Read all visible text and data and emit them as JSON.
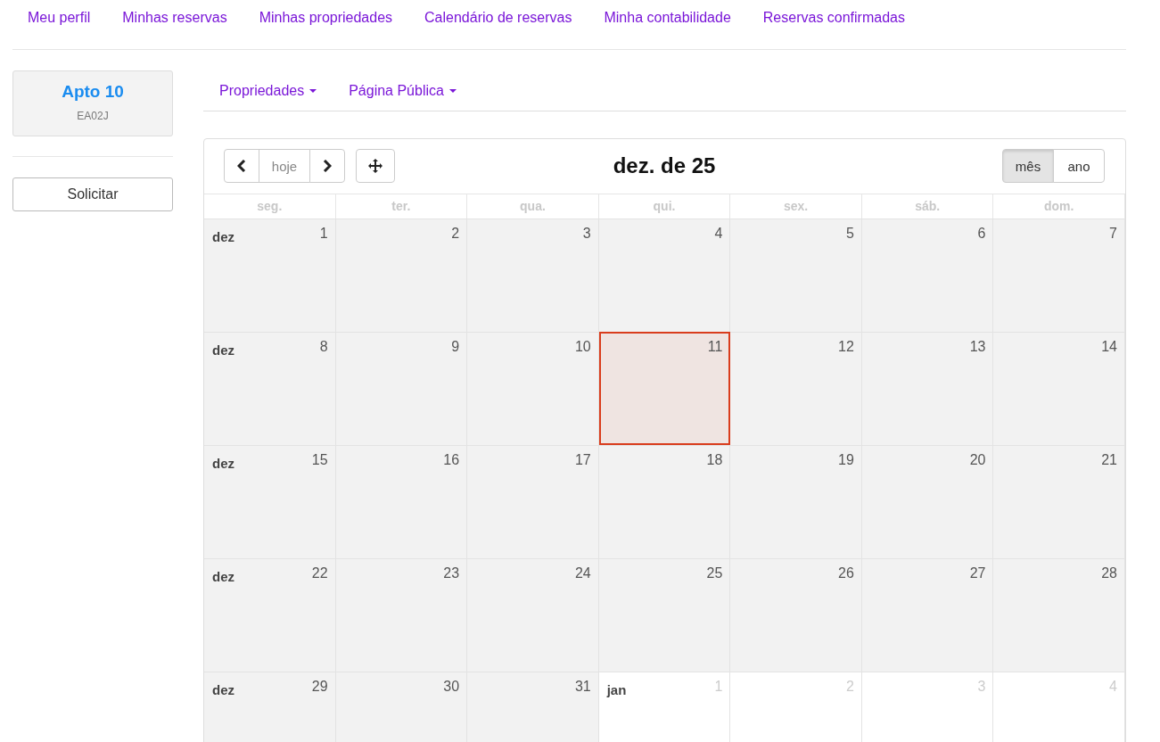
{
  "nav": [
    "Meu perfil",
    "Minhas reservas",
    "Minhas propriedades",
    "Calendário de reservas",
    "Minha contabilidade",
    "Reservas confirmadas"
  ],
  "property": {
    "name": "Apto 10",
    "code": "EA02J"
  },
  "request_button": "Solicitar",
  "menus": [
    "Propriedades",
    "Página Pública"
  ],
  "calendar": {
    "title": "dez. de 25",
    "today_button": "hoje",
    "views": [
      {
        "label": "mês",
        "selected": true
      },
      {
        "label": "ano",
        "selected": false
      }
    ],
    "weekdays": [
      "seg.",
      "ter.",
      "qua.",
      "qui.",
      "sex.",
      "sáb.",
      "dom."
    ],
    "weeks": [
      {
        "month": "dez",
        "days": [
          {
            "day": "1",
            "in_month": true,
            "selected": false
          },
          {
            "day": "2",
            "in_month": true,
            "selected": false
          },
          {
            "day": "3",
            "in_month": true,
            "selected": false
          },
          {
            "day": "4",
            "in_month": true,
            "selected": false
          },
          {
            "day": "5",
            "in_month": true,
            "selected": false
          },
          {
            "day": "6",
            "in_month": true,
            "selected": false
          },
          {
            "day": "7",
            "in_month": true,
            "selected": false
          }
        ]
      },
      {
        "month": "dez",
        "days": [
          {
            "day": "8",
            "in_month": true,
            "selected": false
          },
          {
            "day": "9",
            "in_month": true,
            "selected": false
          },
          {
            "day": "10",
            "in_month": true,
            "selected": false
          },
          {
            "day": "11",
            "in_month": true,
            "selected": true
          },
          {
            "day": "12",
            "in_month": true,
            "selected": false
          },
          {
            "day": "13",
            "in_month": true,
            "selected": false
          },
          {
            "day": "14",
            "in_month": true,
            "selected": false
          }
        ]
      },
      {
        "month": "dez",
        "days": [
          {
            "day": "15",
            "in_month": true,
            "selected": false
          },
          {
            "day": "16",
            "in_month": true,
            "selected": false
          },
          {
            "day": "17",
            "in_month": true,
            "selected": false
          },
          {
            "day": "18",
            "in_month": true,
            "selected": false
          },
          {
            "day": "19",
            "in_month": true,
            "selected": false
          },
          {
            "day": "20",
            "in_month": true,
            "selected": false
          },
          {
            "day": "21",
            "in_month": true,
            "selected": false
          }
        ]
      },
      {
        "month": "dez",
        "days": [
          {
            "day": "22",
            "in_month": true,
            "selected": false
          },
          {
            "day": "23",
            "in_month": true,
            "selected": false
          },
          {
            "day": "24",
            "in_month": true,
            "selected": false
          },
          {
            "day": "25",
            "in_month": true,
            "selected": false
          },
          {
            "day": "26",
            "in_month": true,
            "selected": false
          },
          {
            "day": "27",
            "in_month": true,
            "selected": false
          },
          {
            "day": "28",
            "in_month": true,
            "selected": false
          }
        ]
      },
      {
        "month": "dez",
        "days": [
          {
            "day": "29",
            "in_month": true,
            "selected": false
          },
          {
            "day": "30",
            "in_month": true,
            "selected": false
          },
          {
            "day": "31",
            "in_month": true,
            "selected": false
          },
          {
            "day": "1",
            "in_month": false,
            "selected": false,
            "month": "jan"
          },
          {
            "day": "2",
            "in_month": false,
            "selected": false
          },
          {
            "day": "3",
            "in_month": false,
            "selected": false
          },
          {
            "day": "4",
            "in_month": false,
            "selected": false
          }
        ]
      }
    ]
  }
}
